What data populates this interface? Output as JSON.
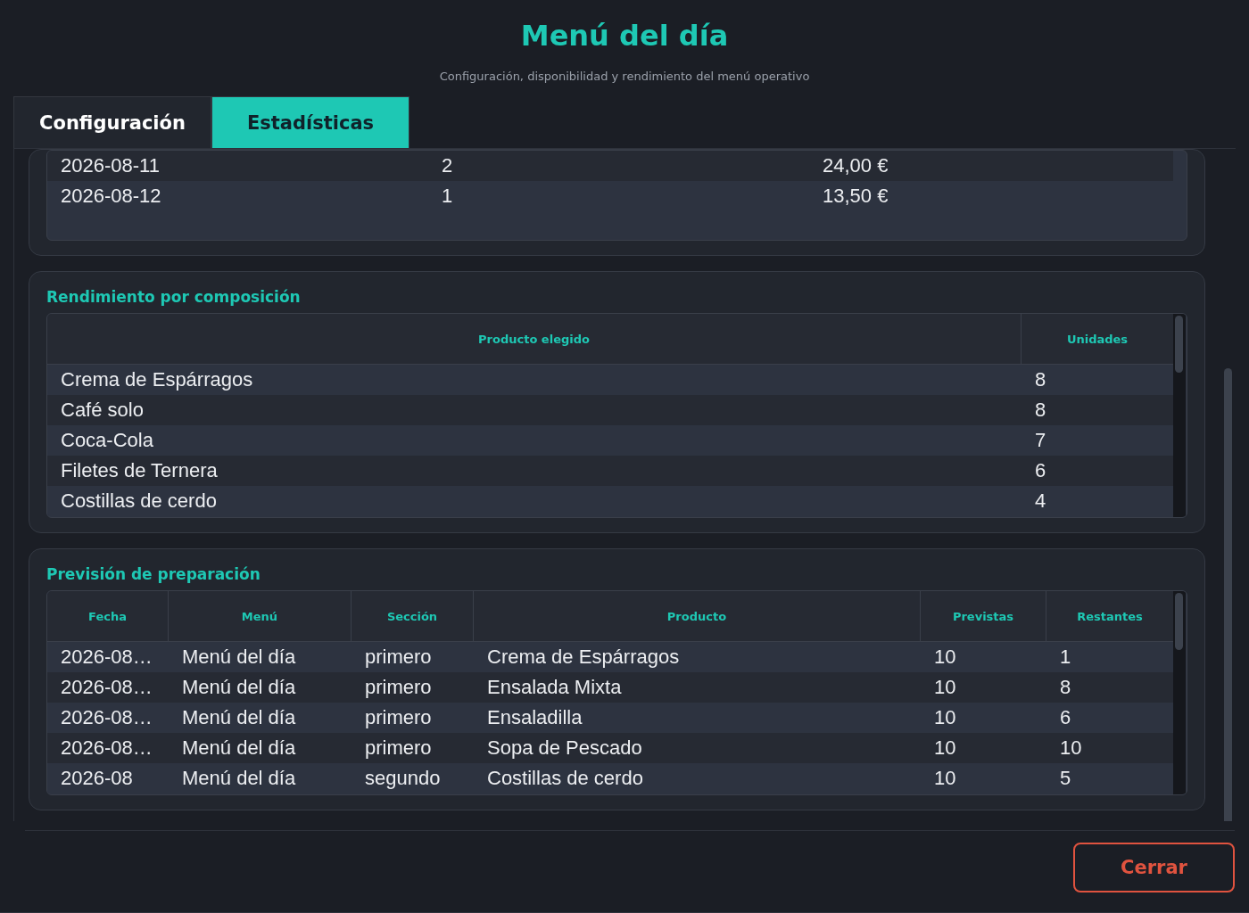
{
  "header": {
    "title": "Menú del día",
    "subtitle": "Configuración, disponibilidad y rendimiento del menú operativo"
  },
  "tabs": [
    {
      "label": "Configuración",
      "selected": false
    },
    {
      "label": "Estadísticas",
      "selected": true
    }
  ],
  "sales_table": {
    "rows": [
      [
        "2026-08-11",
        "2",
        "24,00 €"
      ],
      [
        "2026-08-12",
        "1",
        "13,50 €"
      ]
    ]
  },
  "composition": {
    "title": "Rendimiento por composición",
    "columns": [
      "Producto elegido",
      "Unidades"
    ],
    "rows": [
      [
        "Crema de Espárragos",
        "8"
      ],
      [
        "Café solo",
        "8"
      ],
      [
        "Coca-Cola",
        "7"
      ],
      [
        "Filetes de Ternera",
        "6"
      ],
      [
        "Costillas de cerdo",
        "4"
      ]
    ]
  },
  "forecast": {
    "title": "Previsión de preparación",
    "columns": [
      "Fecha",
      "Menú",
      "Sección",
      "Producto",
      "Previstas",
      "Restantes"
    ],
    "rows": [
      [
        "2026-08…",
        "Menú del día",
        "primero",
        "Crema de Espárragos",
        "10",
        "1"
      ],
      [
        "2026-08…",
        "Menú del día",
        "primero",
        "Ensalada Mixta",
        "10",
        "8"
      ],
      [
        "2026-08…",
        "Menú del día",
        "primero",
        "Ensaladilla",
        "10",
        "6"
      ],
      [
        "2026-08…",
        "Menú del día",
        "primero",
        "Sopa de Pescado",
        "10",
        "10"
      ],
      [
        "2026-08",
        "Menú del día",
        "segundo",
        "Costillas de cerdo",
        "10",
        "5"
      ]
    ]
  },
  "close_button": "Cerrar"
}
